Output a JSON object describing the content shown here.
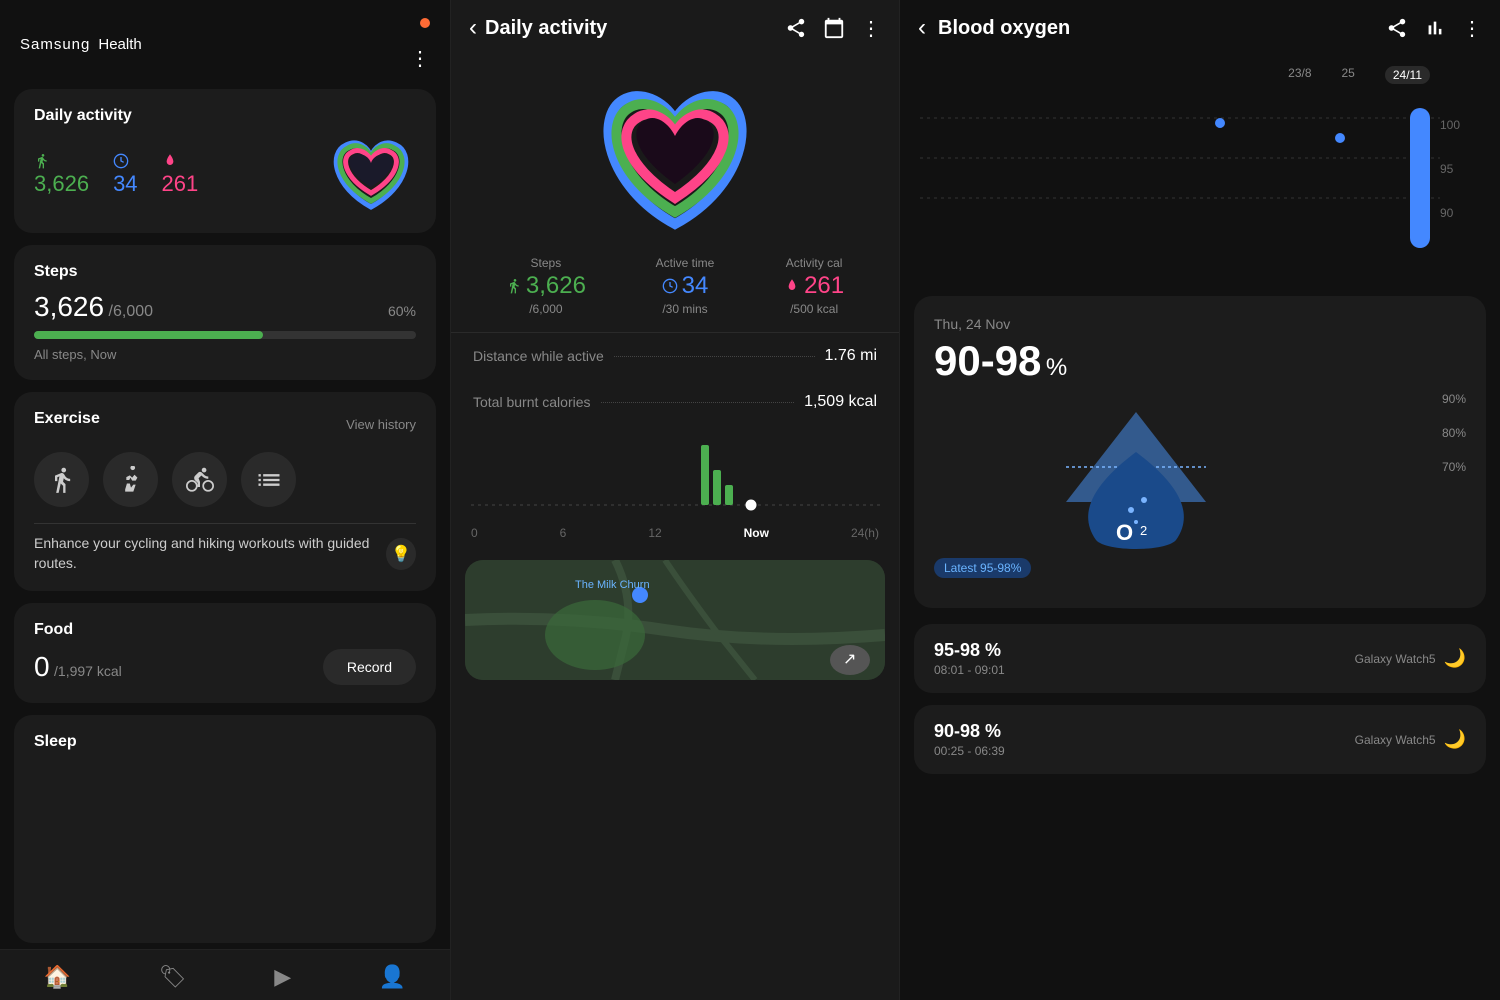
{
  "app": {
    "name": "Samsung",
    "health": "Health",
    "notification": true
  },
  "left_panel": {
    "header": {
      "title": "Samsung Health",
      "menu_icon": "⋮"
    },
    "daily_activity": {
      "title": "Daily activity",
      "steps": {
        "value": "3,626",
        "icon": "steps"
      },
      "active_time": {
        "value": "34",
        "icon": "time"
      },
      "activity_cal": {
        "value": "261",
        "icon": "fire"
      }
    },
    "steps": {
      "title": "Steps",
      "value": "3,626",
      "goal": "/6,000",
      "percent": "60%",
      "progress": 60,
      "sub": "All steps, Now"
    },
    "exercise": {
      "title": "Exercise",
      "view_history": "View history",
      "promo_text": "Enhance your cycling and hiking workouts with guided routes."
    },
    "food": {
      "title": "Food",
      "value": "0",
      "goal": "/1,997 kcal",
      "record_btn": "Record"
    },
    "sleep": {
      "title": "Sleep"
    },
    "nav": {
      "items": [
        "🏠",
        "🏷",
        "▶",
        "👤"
      ]
    }
  },
  "middle_panel": {
    "header": {
      "back": "‹",
      "title": "Daily activity",
      "share_icon": "share",
      "calendar_icon": "calendar",
      "menu_icon": "⋮"
    },
    "stats": {
      "steps": {
        "label": "Steps",
        "value": "3,626",
        "goal": "/6,000",
        "icon": "steps-icon"
      },
      "active_time": {
        "label": "Active time",
        "value": "34",
        "goal": "/30 mins",
        "icon": "time-icon"
      },
      "activity_cal": {
        "label": "Activity cal",
        "value": "261",
        "goal": "/500 kcal",
        "icon": "fire-icon"
      }
    },
    "details": {
      "distance": {
        "label": "Distance while active",
        "value": "1.76 mi"
      },
      "calories": {
        "label": "Total burnt calories",
        "value": "1,509 kcal"
      }
    },
    "chart": {
      "labels": [
        "0",
        "6",
        "12",
        "Now",
        "24(h)"
      ]
    }
  },
  "right_panel": {
    "header": {
      "back": "‹",
      "title": "Blood oxygen",
      "share_icon": "share",
      "bar_icon": "bar-chart",
      "menu_icon": "⋮"
    },
    "graph": {
      "date_labels": [
        "23/8",
        "25",
        "24/11"
      ],
      "y_labels": [
        "100",
        "95",
        "90"
      ]
    },
    "main_card": {
      "date": "Thu, 24 Nov",
      "value": "90-98",
      "percent": "%",
      "latest_badge": "Latest 95-98%",
      "scale": {
        "90_pct": "90%",
        "80_pct": "80%",
        "70_pct": "70%"
      }
    },
    "records": [
      {
        "value": "95-98 %",
        "time": "08:01 - 09:01",
        "device": "Galaxy Watch5",
        "icon": "moon"
      },
      {
        "value": "90-98 %",
        "time": "00:25 - 06:39",
        "device": "Galaxy Watch5",
        "icon": "moon"
      }
    ]
  }
}
